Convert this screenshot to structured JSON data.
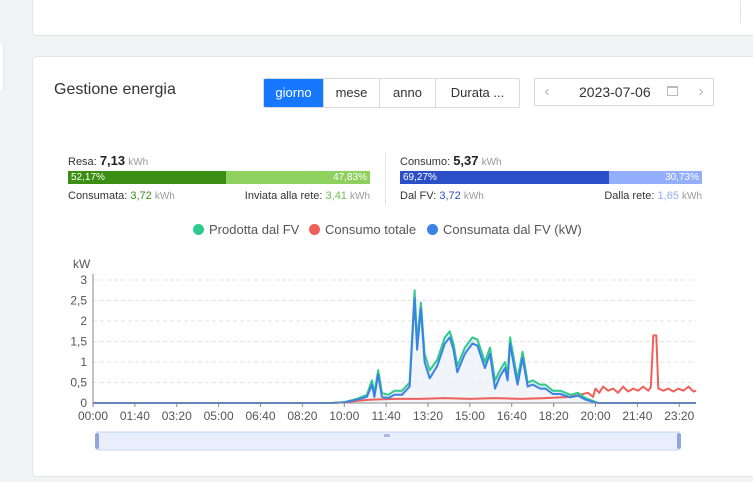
{
  "card": {
    "title": "Gestione energia"
  },
  "tabs": [
    {
      "label": "giorno",
      "active": true
    },
    {
      "label": "mese",
      "active": false
    },
    {
      "label": "anno",
      "active": false
    },
    {
      "label": "Durata ...",
      "active": false
    }
  ],
  "date": {
    "value": "2023-07-06"
  },
  "yield": {
    "label": "Resa:",
    "value": "7,13",
    "unit": "kWh",
    "pct_self": "52,17%",
    "pct_grid": "47,83%",
    "fraction_self": 0.5217,
    "consumed_label": "Consumata:",
    "consumed_value": "3,72",
    "consumed_unit": "kWh",
    "fed_label": "Inviata alla rete:",
    "fed_value": "3,41",
    "fed_unit": "kWh",
    "color_self": "#3a8e12",
    "color_grid": "#8fd15f"
  },
  "consumption": {
    "label": "Consumo:",
    "value": "5,37",
    "unit": "kWh",
    "pct_pv": "69,27%",
    "pct_grid": "30,73%",
    "fraction_pv": 0.6927,
    "pv_label": "Dal FV:",
    "pv_value": "3,72",
    "pv_unit": "kWh",
    "grid_label": "Dalla rete:",
    "grid_value": "1,65",
    "grid_unit": "kWh",
    "color_pv": "#2b4fc7",
    "color_grid": "#93aefb"
  },
  "chart_data": {
    "type": "line",
    "ylabel": "kW",
    "ylim": [
      0,
      3
    ],
    "yticks": [
      "0",
      "0,5",
      "1",
      "1,5",
      "2",
      "2,5",
      "3"
    ],
    "xticks": [
      "00:00",
      "01:40",
      "03:20",
      "05:00",
      "06:40",
      "08:20",
      "10:00",
      "11:40",
      "13:20",
      "15:00",
      "16:40",
      "18:20",
      "20:00",
      "21:40",
      "23:20"
    ],
    "xlim_hours": [
      0,
      24
    ],
    "grid": "horizontal dashed",
    "legend_position": "top-center",
    "series": [
      {
        "name": "Prodotta dal FV",
        "color": "#2ecb8b",
        "points": [
          [
            0,
            0
          ],
          [
            9.5,
            0
          ],
          [
            10,
            0.02
          ],
          [
            10.5,
            0.1
          ],
          [
            10.9,
            0.2
          ],
          [
            11.1,
            0.55
          ],
          [
            11.2,
            0.25
          ],
          [
            11.35,
            0.8
          ],
          [
            11.5,
            0.25
          ],
          [
            11.75,
            0.2
          ],
          [
            12,
            0.3
          ],
          [
            12.3,
            0.3
          ],
          [
            12.6,
            0.5
          ],
          [
            12.8,
            2.75
          ],
          [
            12.9,
            1.5
          ],
          [
            13.05,
            2.45
          ],
          [
            13.2,
            1.2
          ],
          [
            13.4,
            0.8
          ],
          [
            13.7,
            1.05
          ],
          [
            14,
            1.6
          ],
          [
            14.2,
            1.75
          ],
          [
            14.35,
            1.45
          ],
          [
            14.5,
            0.9
          ],
          [
            14.8,
            1.35
          ],
          [
            15.1,
            1.6
          ],
          [
            15.3,
            1.55
          ],
          [
            15.6,
            1.0
          ],
          [
            15.8,
            1.35
          ],
          [
            16,
            0.55
          ],
          [
            16.2,
            0.8
          ],
          [
            16.4,
            1.0
          ],
          [
            16.5,
            0.7
          ],
          [
            16.6,
            1.6
          ],
          [
            16.8,
            0.9
          ],
          [
            16.9,
            0.6
          ],
          [
            17.1,
            1.25
          ],
          [
            17.3,
            0.5
          ],
          [
            17.5,
            0.55
          ],
          [
            17.8,
            0.45
          ],
          [
            18,
            0.45
          ],
          [
            18.3,
            0.3
          ],
          [
            18.6,
            0.3
          ],
          [
            19,
            0.2
          ],
          [
            19.3,
            0.25
          ],
          [
            19.6,
            0.12
          ],
          [
            19.9,
            0.05
          ],
          [
            20.1,
            0
          ],
          [
            24,
            0
          ]
        ]
      },
      {
        "name": "Consumo totale",
        "color": "#f0605b",
        "points": [
          [
            0,
            0
          ],
          [
            9.5,
            0
          ],
          [
            10,
            0.02
          ],
          [
            10.5,
            0.05
          ],
          [
            11,
            0.08
          ],
          [
            12,
            0.1
          ],
          [
            13,
            0.1
          ],
          [
            14,
            0.12
          ],
          [
            15,
            0.1
          ],
          [
            16,
            0.12
          ],
          [
            17,
            0.1
          ],
          [
            18,
            0.12
          ],
          [
            19,
            0.15
          ],
          [
            19.7,
            0.25
          ],
          [
            19.9,
            0.15
          ],
          [
            20,
            0.35
          ],
          [
            20.15,
            0.25
          ],
          [
            20.3,
            0.4
          ],
          [
            20.5,
            0.3
          ],
          [
            20.7,
            0.35
          ],
          [
            20.9,
            0.25
          ],
          [
            21.1,
            0.4
          ],
          [
            21.3,
            0.28
          ],
          [
            21.5,
            0.35
          ],
          [
            21.7,
            0.3
          ],
          [
            21.9,
            0.4
          ],
          [
            22.1,
            0.3
          ],
          [
            22.2,
            0.38
          ],
          [
            22.3,
            1.65
          ],
          [
            22.42,
            1.65
          ],
          [
            22.5,
            0.35
          ],
          [
            22.7,
            0.3
          ],
          [
            22.9,
            0.35
          ],
          [
            23.1,
            0.28
          ],
          [
            23.3,
            0.35
          ],
          [
            23.5,
            0.3
          ],
          [
            23.7,
            0.4
          ],
          [
            23.9,
            0.28
          ],
          [
            24,
            0.3
          ]
        ]
      },
      {
        "name": "Consumata dal FV (kW)",
        "color": "#3b82e6",
        "points": [
          [
            0,
            0
          ],
          [
            9.5,
            0
          ],
          [
            10,
            0.02
          ],
          [
            10.5,
            0.08
          ],
          [
            10.9,
            0.15
          ],
          [
            11.1,
            0.45
          ],
          [
            11.2,
            0.15
          ],
          [
            11.35,
            0.7
          ],
          [
            11.5,
            0.15
          ],
          [
            11.75,
            0.12
          ],
          [
            12,
            0.2
          ],
          [
            12.3,
            0.2
          ],
          [
            12.6,
            0.4
          ],
          [
            12.8,
            2.55
          ],
          [
            12.9,
            1.3
          ],
          [
            13.05,
            2.3
          ],
          [
            13.2,
            1.0
          ],
          [
            13.4,
            0.6
          ],
          [
            13.7,
            0.9
          ],
          [
            14,
            1.45
          ],
          [
            14.2,
            1.6
          ],
          [
            14.35,
            1.3
          ],
          [
            14.5,
            0.75
          ],
          [
            14.8,
            1.2
          ],
          [
            15.1,
            1.45
          ],
          [
            15.3,
            1.4
          ],
          [
            15.6,
            0.85
          ],
          [
            15.8,
            1.2
          ],
          [
            16,
            0.35
          ],
          [
            16.2,
            0.65
          ],
          [
            16.4,
            0.85
          ],
          [
            16.5,
            0.55
          ],
          [
            16.6,
            1.45
          ],
          [
            16.8,
            0.75
          ],
          [
            16.9,
            0.45
          ],
          [
            17.1,
            1.1
          ],
          [
            17.3,
            0.4
          ],
          [
            17.5,
            0.45
          ],
          [
            17.8,
            0.35
          ],
          [
            18,
            0.35
          ],
          [
            18.3,
            0.22
          ],
          [
            18.6,
            0.22
          ],
          [
            19,
            0.14
          ],
          [
            19.3,
            0.18
          ],
          [
            19.6,
            0.08
          ],
          [
            19.9,
            0.03
          ],
          [
            20.1,
            0
          ],
          [
            24,
            0
          ]
        ]
      }
    ]
  }
}
